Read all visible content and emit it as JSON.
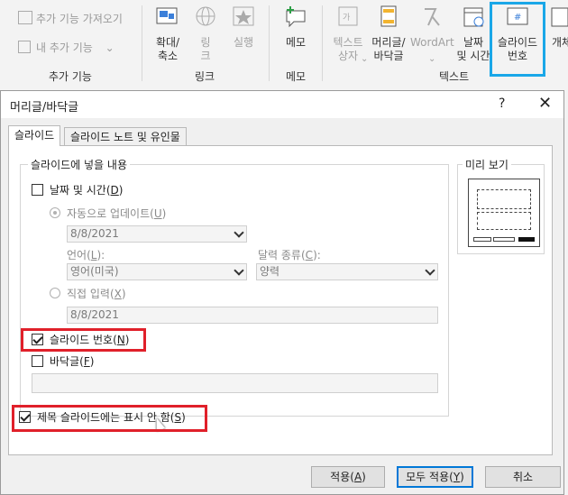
{
  "ribbon": {
    "addins": {
      "get_addins": "추가 기능 가져오기",
      "my_addins": "내 추가 기능",
      "group_label": "추가 기능"
    },
    "links": {
      "zoom": "확대/\n축소",
      "link": "링\n크",
      "action": "실행",
      "group_label": "링크"
    },
    "comments": {
      "memo": "메모",
      "group_label": "메모"
    },
    "text": {
      "textbox": "텍스트\n상자",
      "header_footer": "머리글/\n바닥글",
      "wordart": "WordArt",
      "datetime": "날짜\n및 시간",
      "slide_number": "슬라이드\n번호",
      "object": "개체",
      "group_label": "텍스트"
    },
    "highlight_color": "#1aa7e8"
  },
  "dialog": {
    "title": "머리글/바닥글",
    "help": "?",
    "close": "✕",
    "tabs": [
      {
        "label": "슬라이드",
        "active": true
      },
      {
        "label": "슬라이드 노트 및 유인물",
        "active": false
      }
    ],
    "include_group": "슬라이드에 넣을 내용",
    "date_time": {
      "label": "날짜 및 시간",
      "accel": "D",
      "checked": false
    },
    "auto_update": {
      "label": "자동으로 업데이트",
      "accel": "U",
      "selected": true,
      "value": "8/8/2021"
    },
    "language": {
      "label": "언어",
      "accel": "L",
      "value": "영어(미국)"
    },
    "calendar": {
      "label": "달력 종류",
      "accel": "C",
      "value": "양력"
    },
    "fixed": {
      "label": "직접 입력",
      "accel": "X",
      "selected": false,
      "value": "8/8/2021"
    },
    "slide_number": {
      "label": "슬라이드 번호",
      "accel": "N",
      "checked": true
    },
    "footer": {
      "label": "바닥글",
      "accel": "F",
      "checked": false,
      "value": ""
    },
    "dont_show_title": {
      "label": "제목 슬라이드에는 표시 안 함",
      "accel": "S",
      "checked": true
    },
    "preview_label": "미리 보기",
    "buttons": {
      "apply": "적용",
      "apply_accel": "A",
      "apply_all": "모두 적용",
      "apply_all_accel": "Y",
      "cancel": "취소"
    },
    "highlight_color": "#e0202a"
  }
}
